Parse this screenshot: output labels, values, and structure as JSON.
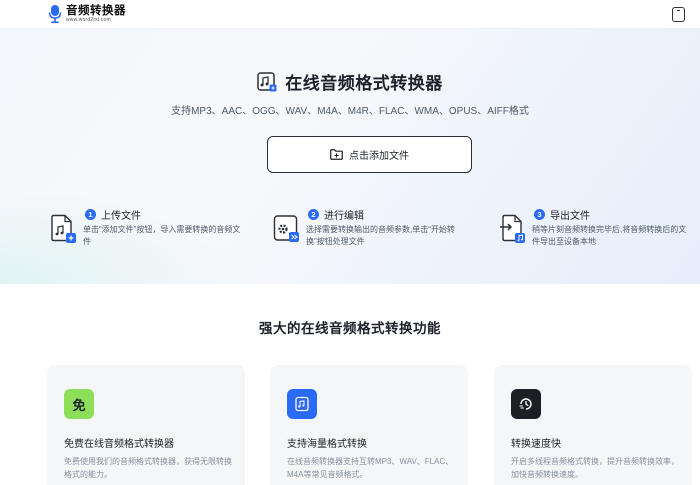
{
  "header": {
    "logo_title": "音频转换器",
    "logo_subtitle": "www.word2txt.com",
    "device_icon": "tablet-icon"
  },
  "hero": {
    "title": "在线音频格式转换器",
    "formats": "支持MP3、AAC、OGG、WAV、M4A、M4R、FLAC、WMA、OPUS、AIFF格式",
    "add_file_label": "点击添加文件"
  },
  "steps": [
    {
      "num": "1",
      "title": "上传文件",
      "desc": "单击“添加文件”按钮，导入需要转换的音频文件",
      "icon": "upload-file-icon"
    },
    {
      "num": "2",
      "title": "进行编辑",
      "desc": "选择需要转换输出的音频参数,单击“开始转换”按钮处理文件",
      "icon": "edit-settings-icon"
    },
    {
      "num": "3",
      "title": "导出文件",
      "desc": "稍等片刻音频转换完毕后,将音频转换后的文件导出至设备本地",
      "icon": "export-file-icon"
    }
  ],
  "features": {
    "section_title": "强大的在线音频格式转换功能",
    "cards": [
      {
        "icon_text": "免",
        "title": "免费在线音频格式转换器",
        "desc": "免费使用我们的音频格式转换器，获得无限转换格式的能力。",
        "color": "#8ddf5a"
      },
      {
        "title": "支持海量格式转换",
        "desc": "在线音频转换器支持互转MP3、WAV、FLAC、M4A等常见音频格式。",
        "color": "#2a6af5"
      },
      {
        "title": "转换速度快",
        "desc": "开启多线程音频格式转换，提升音频转换效率，加快音频转换速度。",
        "color": "#1d1f24"
      }
    ]
  },
  "colors": {
    "accent": "#2a6af5",
    "green": "#8ddf5a",
    "dark": "#1d1f24"
  }
}
